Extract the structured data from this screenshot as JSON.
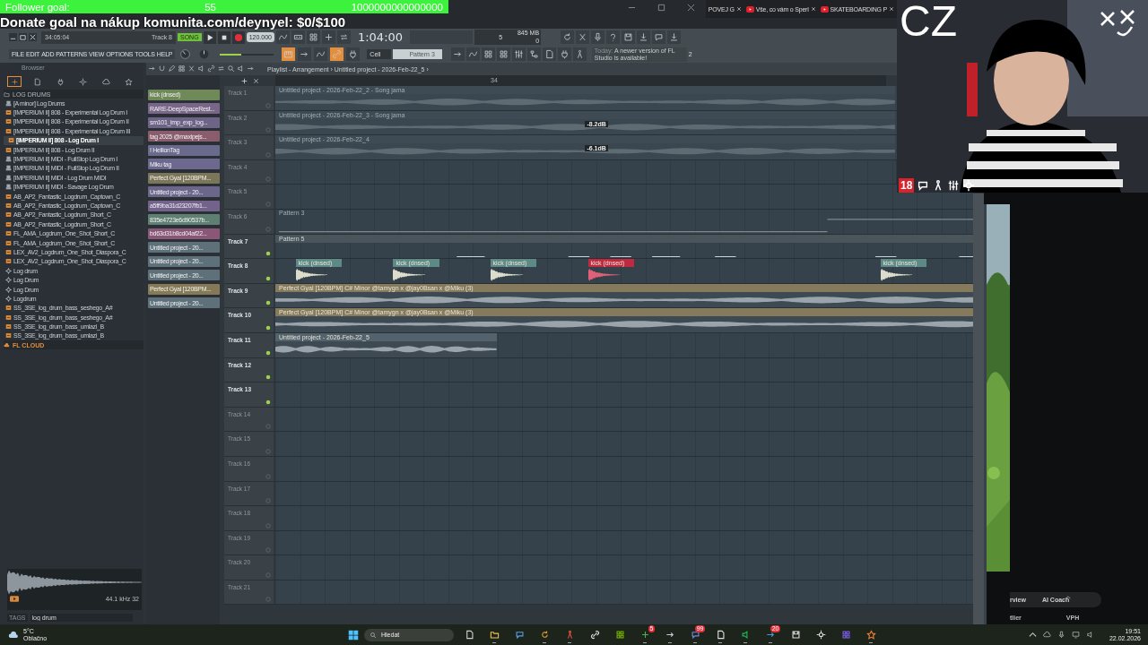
{
  "overlay": {
    "follower_label": "Follower goal:",
    "follower_count": "55",
    "follower_target": "1000000000000000",
    "donate": "Donate goal na nákup komunita.com/deynyel: $0/$100"
  },
  "browser_tabs": [
    {
      "title": "POVEJ G",
      "favicon": false
    },
    {
      "title": "Vše, co vám o Sperl",
      "favicon": true
    },
    {
      "title": "SKATEBOARDING P",
      "favicon": true
    }
  ],
  "toolbar": {
    "time": "34:05:04",
    "hint": "Track 8",
    "song_label": "SONG",
    "song_on": true,
    "tempo": "120.000",
    "position": "1:04:00",
    "cpu": "5",
    "memory": "845 MB",
    "polyphony": "0",
    "menu": [
      "FILE",
      "EDIT",
      "ADD",
      "PATTERNS",
      "VIEW",
      "OPTIONS",
      "TOOLS",
      "HELP"
    ],
    "master_slider": {
      "level": 0.4
    },
    "toggles": [
      {
        "on": true
      },
      {
        "on": false
      },
      {
        "on": false
      },
      {
        "on": true
      },
      {
        "on": false
      }
    ],
    "snap": "Cell",
    "pattern": "Pattern 3",
    "news_date": "Today:",
    "news": "A newer version of FL Studio is available!",
    "news_count": "2"
  },
  "browser": {
    "title": "Browser",
    "tab_icons": [
      {
        "selected": true
      },
      {
        "selected": false
      },
      {
        "selected": false
      },
      {
        "selected": false
      },
      {
        "selected": false
      },
      {
        "selected": false
      }
    ],
    "folder": "LOG DRUMS",
    "items": [
      {
        "kind": "score",
        "label": "[A minor] Log Drums",
        "selected": false
      },
      {
        "kind": "audio",
        "label": "[IMPERIUM II] 808 - Experimental Log Drum I",
        "selected": false
      },
      {
        "kind": "audio",
        "label": "[IMPERIUM II] 808 - Experimental Log Drum II",
        "selected": false
      },
      {
        "kind": "audio",
        "label": "[IMPERIUM II] 808 - Experimental Log Drum III",
        "selected": false
      },
      {
        "kind": "audio",
        "label": "[IMPERIUM II] 808 - Log Drum I",
        "selected": true
      },
      {
        "kind": "audio",
        "label": "[IMPERIUM II] 808 - Log Drum II",
        "selected": false
      },
      {
        "kind": "score",
        "label": "[IMPERIUM II] MIDI - FullStop Log Drum I",
        "selected": false
      },
      {
        "kind": "score",
        "label": "[IMPERIUM II] MIDI - FullStop Log Drum II",
        "selected": false
      },
      {
        "kind": "score",
        "label": "[IMPERIUM II] MIDI - Log Drum MIDI",
        "selected": false
      },
      {
        "kind": "score",
        "label": "[IMPERIUM II] MIDI - Savage Log Drum",
        "selected": false
      },
      {
        "kind": "audio",
        "label": "AB_AP2_Fantastic_Logdrum_Captown_C",
        "selected": false
      },
      {
        "kind": "audio",
        "label": "AB_AP2_Fantastic_Logdrum_Captown_C",
        "selected": false
      },
      {
        "kind": "audio",
        "label": "AB_AP2_Fantastic_Logdrum_Short_C",
        "selected": false
      },
      {
        "kind": "audio",
        "label": "AB_AP2_Fantastic_Logdrum_Short_C",
        "selected": false
      },
      {
        "kind": "audio",
        "label": "FL_AMA_Logdrum_One_Shot_Short_C",
        "selected": false
      },
      {
        "kind": "audio",
        "label": "FL_AMA_Logdrum_One_Shot_Short_C",
        "selected": false
      },
      {
        "kind": "audio",
        "label": "LEX_AV2_Logdrum_One_Shot_Diaspora_C",
        "selected": false
      },
      {
        "kind": "audio",
        "label": "LEX_AV2_Logdrum_One_Shot_Diaspora_C",
        "selected": false
      },
      {
        "kind": "preset",
        "label": "Log drum",
        "selected": false
      },
      {
        "kind": "preset",
        "label": "Log Drum",
        "selected": false
      },
      {
        "kind": "preset",
        "label": "Log Drum",
        "selected": false
      },
      {
        "kind": "preset",
        "label": "Logdrum",
        "selected": false
      },
      {
        "kind": "audio",
        "label": "SS_3SE_log_drum_bass_seshego_A#",
        "selected": false
      },
      {
        "kind": "audio",
        "label": "SS_3SE_log_drum_bass_seshego_A#",
        "selected": false
      },
      {
        "kind": "audio",
        "label": "SS_3SE_log_drum_bass_umlazi_B",
        "selected": false
      },
      {
        "kind": "audio",
        "label": "SS_3SE_log_drum_bass_umlazi_B",
        "selected": false
      }
    ],
    "cloud": "FL CLOUD",
    "sample_info": "44.1 kHz 32",
    "tags_label": "TAGS",
    "tags_search": "log drum"
  },
  "channels": [
    {
      "label": "kick (dnsed)",
      "color": "#6f8a58"
    },
    {
      "label": "RARE-DeepSpaceRest...",
      "color": "#7a6689"
    },
    {
      "label": "sm101_imp_exp_log...",
      "color": "#6d6487"
    },
    {
      "label": "tag 2025 @maxipejs...",
      "color": "#8a5d6c"
    },
    {
      "label": "! HellionTag",
      "color": "#6a6a8c"
    },
    {
      "label": "Miku tag",
      "color": "#6c6890"
    },
    {
      "label": "Perfect Gyal [120BPM...",
      "color": "#7b7657"
    },
    {
      "label": "Untitled project - 20...",
      "color": "#6a678a"
    },
    {
      "label": "a5ff9ba31d23207fb1...",
      "color": "#72628c"
    },
    {
      "label": "835e4723e6d90537b...",
      "color": "#5f7f73"
    },
    {
      "label": "bd63d31b8cd04af22...",
      "color": "#8a5779"
    },
    {
      "label": "Untitled project - 20...",
      "color": "#5e717b"
    },
    {
      "label": "Untitled project - 20...",
      "color": "#5e717b"
    },
    {
      "label": "Untitled project - 20...",
      "color": "#5e717b"
    },
    {
      "label": "Perfect Gyal [120BPM...",
      "color": "#857a55"
    },
    {
      "label": "Untitled project - 20...",
      "color": "#5e717b"
    }
  ],
  "playlist": {
    "title": "Playlist - Arrangement › Untitled project - 2026-Feb-22_5 ›",
    "ruler_mark": "34",
    "tracks": [
      {
        "name": "Track 1",
        "enabled": false,
        "clips": [
          {
            "kind": "audio",
            "label": "Untitled project - 2026-Feb-22_2 - Song jama"
          }
        ]
      },
      {
        "name": "Track 2",
        "enabled": false,
        "clips": [
          {
            "kind": "audio",
            "label": "Untitled project - 2026-Feb-22_3 - Song jama",
            "marker": "-8.2dB"
          }
        ]
      },
      {
        "name": "Track 3",
        "enabled": false,
        "clips": [
          {
            "kind": "audio",
            "label": "Untitled project - 2026-Feb-22_4",
            "marker": "-6.1dB"
          }
        ]
      },
      {
        "name": "Track 4",
        "enabled": false
      },
      {
        "name": "Track 5",
        "enabled": false
      },
      {
        "name": "Track 6",
        "enabled": false,
        "clips": [
          {
            "kind": "automation",
            "label": "Pattern 3"
          }
        ]
      },
      {
        "name": "Track 7",
        "enabled": true,
        "clips": [
          {
            "kind": "pattern",
            "label": "Pattern 5"
          }
        ]
      },
      {
        "name": "Track 8",
        "enabled": true,
        "clips": [
          {
            "kind": "sample",
            "label": "kick (dnsed)",
            "selected": false
          },
          {
            "kind": "sample",
            "label": "kick (dnsed)",
            "selected": false
          },
          {
            "kind": "sample",
            "label": "kick (dnsed)",
            "selected": false
          },
          {
            "kind": "sample",
            "label": "kick (dnsed)",
            "selected": true
          },
          {
            "kind": "sample",
            "label": "kick (dnsed)",
            "selected": false
          }
        ]
      },
      {
        "name": "Track 9",
        "enabled": true,
        "clips": [
          {
            "kind": "audio",
            "label": "Perfect Gyal [120BPM] C# Minor @tamygn x @jay0Bsan x @Miku (3)",
            "color": "#857a5c"
          }
        ]
      },
      {
        "name": "Track 10",
        "enabled": true,
        "clips": [
          {
            "kind": "audio",
            "label": "Perfect Gyal [120BPM] C# Minor @tamygn x @jay0Bsan x @Miku (3)",
            "color": "#857a5c"
          }
        ]
      },
      {
        "name": "Track 11",
        "enabled": true,
        "clips": [
          {
            "kind": "audio",
            "label": "Untitled project - 2026-Feb-22_5",
            "color": "#53626d"
          }
        ]
      },
      {
        "name": "Track 12",
        "enabled": true
      },
      {
        "name": "Track 13",
        "enabled": true
      },
      {
        "name": "Track 14",
        "enabled": false
      },
      {
        "name": "Track 15",
        "enabled": false
      },
      {
        "name": "Track 16",
        "enabled": false
      },
      {
        "name": "Track 17",
        "enabled": false
      },
      {
        "name": "Track 18",
        "enabled": false
      },
      {
        "name": "Track 19",
        "enabled": false
      },
      {
        "name": "Track 20",
        "enabled": false
      },
      {
        "name": "Track 21",
        "enabled": false
      }
    ]
  },
  "webcam": {
    "country": "CZ",
    "age_badge": "18"
  },
  "side_panel": {
    "tabs": [
      "rview",
      "AI Coach"
    ],
    "columns": [
      "tlier",
      "VPH"
    ]
  },
  "taskbar": {
    "temperature": "5°C",
    "weather": "Oblačno",
    "search": "Hledat",
    "apps": [
      {
        "running": false
      },
      {
        "running": true
      },
      {
        "running": false
      },
      {
        "running": true
      },
      {
        "running": true
      },
      {
        "running": false
      },
      {
        "running": false
      },
      {
        "running": true,
        "badge": "5"
      },
      {
        "running": true
      },
      {
        "running": true,
        "badge": "99"
      },
      {
        "running": true
      },
      {
        "running": true
      },
      {
        "running": true,
        "badge": "20"
      },
      {
        "running": false
      },
      {
        "running": false
      },
      {
        "running": false
      },
      {
        "running": true
      }
    ],
    "time": "19:51",
    "date": "22.02.2026"
  }
}
